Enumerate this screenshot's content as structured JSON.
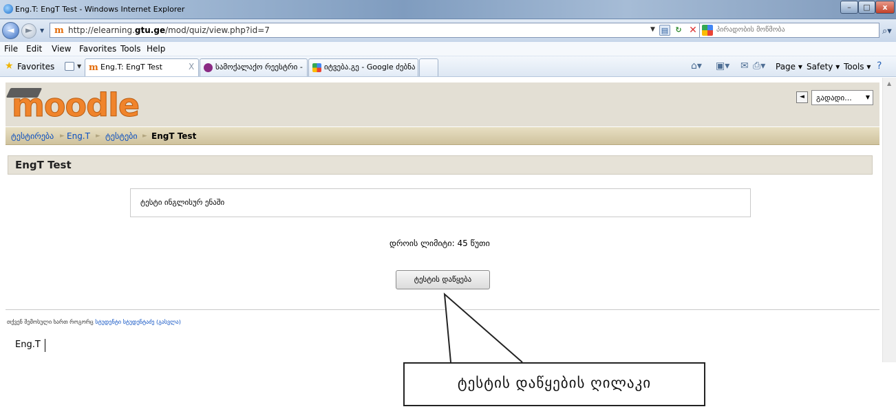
{
  "window": {
    "title": "Eng.T: EngT Test - Windows Internet Explorer",
    "controls": {
      "minimize": "–",
      "maximize": "□",
      "close": "x"
    }
  },
  "address_bar": {
    "url_prefix": "http://elearning.",
    "url_domain": "gtu.ge",
    "url_suffix": "/mod/quiz/view.php?id=7"
  },
  "search": {
    "placeholder": "პირადობის მოწმობა"
  },
  "menu": [
    "File",
    "Edit",
    "View",
    "Favorites",
    "Tools",
    "Help"
  ],
  "favorites_bar": {
    "label": "Favorites",
    "tabs": [
      {
        "label": "Eng.T: EngT Test",
        "active": true,
        "close": "X"
      },
      {
        "label": "სამოქალაქო რეესტრი - პირა...",
        "active": false
      },
      {
        "label": "იტვება.გე - Google ძებნა",
        "active": false
      }
    ],
    "commands": {
      "page": "Page ▾",
      "safety": "Safety ▾",
      "tools": "Tools ▾"
    }
  },
  "moodle": {
    "logo_text": "moodle",
    "jump_to": "გადადი...",
    "breadcrumb": [
      "ტესტირება",
      "Eng.T",
      "ტესტები",
      "EngT Test"
    ],
    "breadcrumb_separator": "►",
    "heading": "EngT Test",
    "intro": "ტესტი ინგლისურ ენაში",
    "time_limit": "დროის ლიმიტი: 45 წუთი",
    "start_button": "ტესტის დაწყება",
    "login_prefix": "თქვენ შემოსული ხართ როგორც ",
    "login_user": "სტუდენტი სტუდენტაძე",
    "login_logout": " (გასვლა)",
    "course_link": "Eng.T"
  },
  "callout": {
    "text": "ტესტის დაწყების ღილაკი"
  },
  "colors": {
    "moodle_orange": "#f0842b",
    "header_beige": "#e3dfd4",
    "breadcrumb_tan": "#cfc29d",
    "link_blue": "#0a4fc2"
  }
}
